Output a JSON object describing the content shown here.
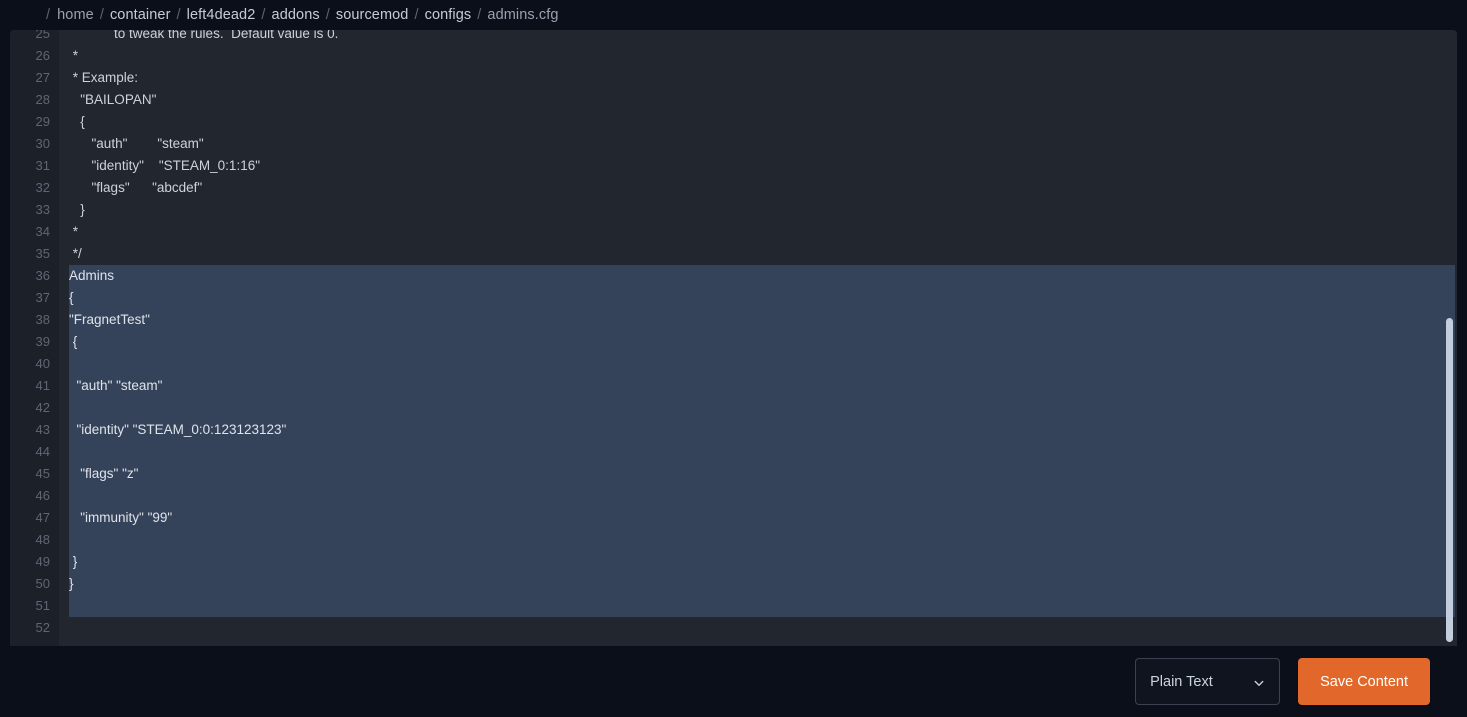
{
  "breadcrumb": {
    "name": "file-path-breadcrumb",
    "leading_separator": "/",
    "separator": "/",
    "segments": [
      {
        "label": "home",
        "dim": true
      },
      {
        "label": "container",
        "dim": false
      },
      {
        "label": "left4dead2",
        "dim": false
      },
      {
        "label": "addons",
        "dim": false
      },
      {
        "label": "sourcemod",
        "dim": false
      },
      {
        "label": "configs",
        "dim": false
      },
      {
        "label": "admins.cfg",
        "dim": true
      }
    ]
  },
  "editor": {
    "first_visible_line": 25,
    "selection_start_line": 36,
    "selection_end_line": 51,
    "colors": {
      "panel_bg": "#22262f",
      "gutter_bg": "#1c2029",
      "selection": "#34425a",
      "text": "#ced2d8",
      "line_number": "#5e6675"
    },
    "lines": [
      {
        "n": 25,
        "text": "            to tweak the rules.  Default value is 0."
      },
      {
        "n": 26,
        "text": " *"
      },
      {
        "n": 27,
        "text": " * Example:"
      },
      {
        "n": 28,
        "text": "   \"BAILOPAN\""
      },
      {
        "n": 29,
        "text": "   {"
      },
      {
        "n": 30,
        "text": "      \"auth\"        \"steam\""
      },
      {
        "n": 31,
        "text": "      \"identity\"    \"STEAM_0:1:16\""
      },
      {
        "n": 32,
        "text": "      \"flags\"      \"abcdef\""
      },
      {
        "n": 33,
        "text": "   }"
      },
      {
        "n": 34,
        "text": " *"
      },
      {
        "n": 35,
        "text": " */"
      },
      {
        "n": 36,
        "text": "Admins"
      },
      {
        "n": 37,
        "text": "{"
      },
      {
        "n": 38,
        "text": "\"FragnetTest\""
      },
      {
        "n": 39,
        "text": " {"
      },
      {
        "n": 40,
        "text": ""
      },
      {
        "n": 41,
        "text": "  \"auth\" \"steam\""
      },
      {
        "n": 42,
        "text": ""
      },
      {
        "n": 43,
        "text": "  \"identity\" \"STEAM_0:0:123123123\""
      },
      {
        "n": 44,
        "text": ""
      },
      {
        "n": 45,
        "text": "   \"flags\" \"z\""
      },
      {
        "n": 46,
        "text": ""
      },
      {
        "n": 47,
        "text": "   \"immunity\" \"99\""
      },
      {
        "n": 48,
        "text": ""
      },
      {
        "n": 49,
        "text": " }"
      },
      {
        "n": 50,
        "text": "}"
      },
      {
        "n": 51,
        "text": ""
      },
      {
        "n": 52,
        "text": ""
      }
    ]
  },
  "scrollbar": {
    "name": "vertical-scrollbar",
    "thumb_color": "#c2cede"
  },
  "footer": {
    "syntax_select": {
      "value": "Plain Text",
      "icon": "chevron-down-icon"
    },
    "save_button": {
      "label": "Save Content",
      "color": "#e1682a"
    }
  }
}
